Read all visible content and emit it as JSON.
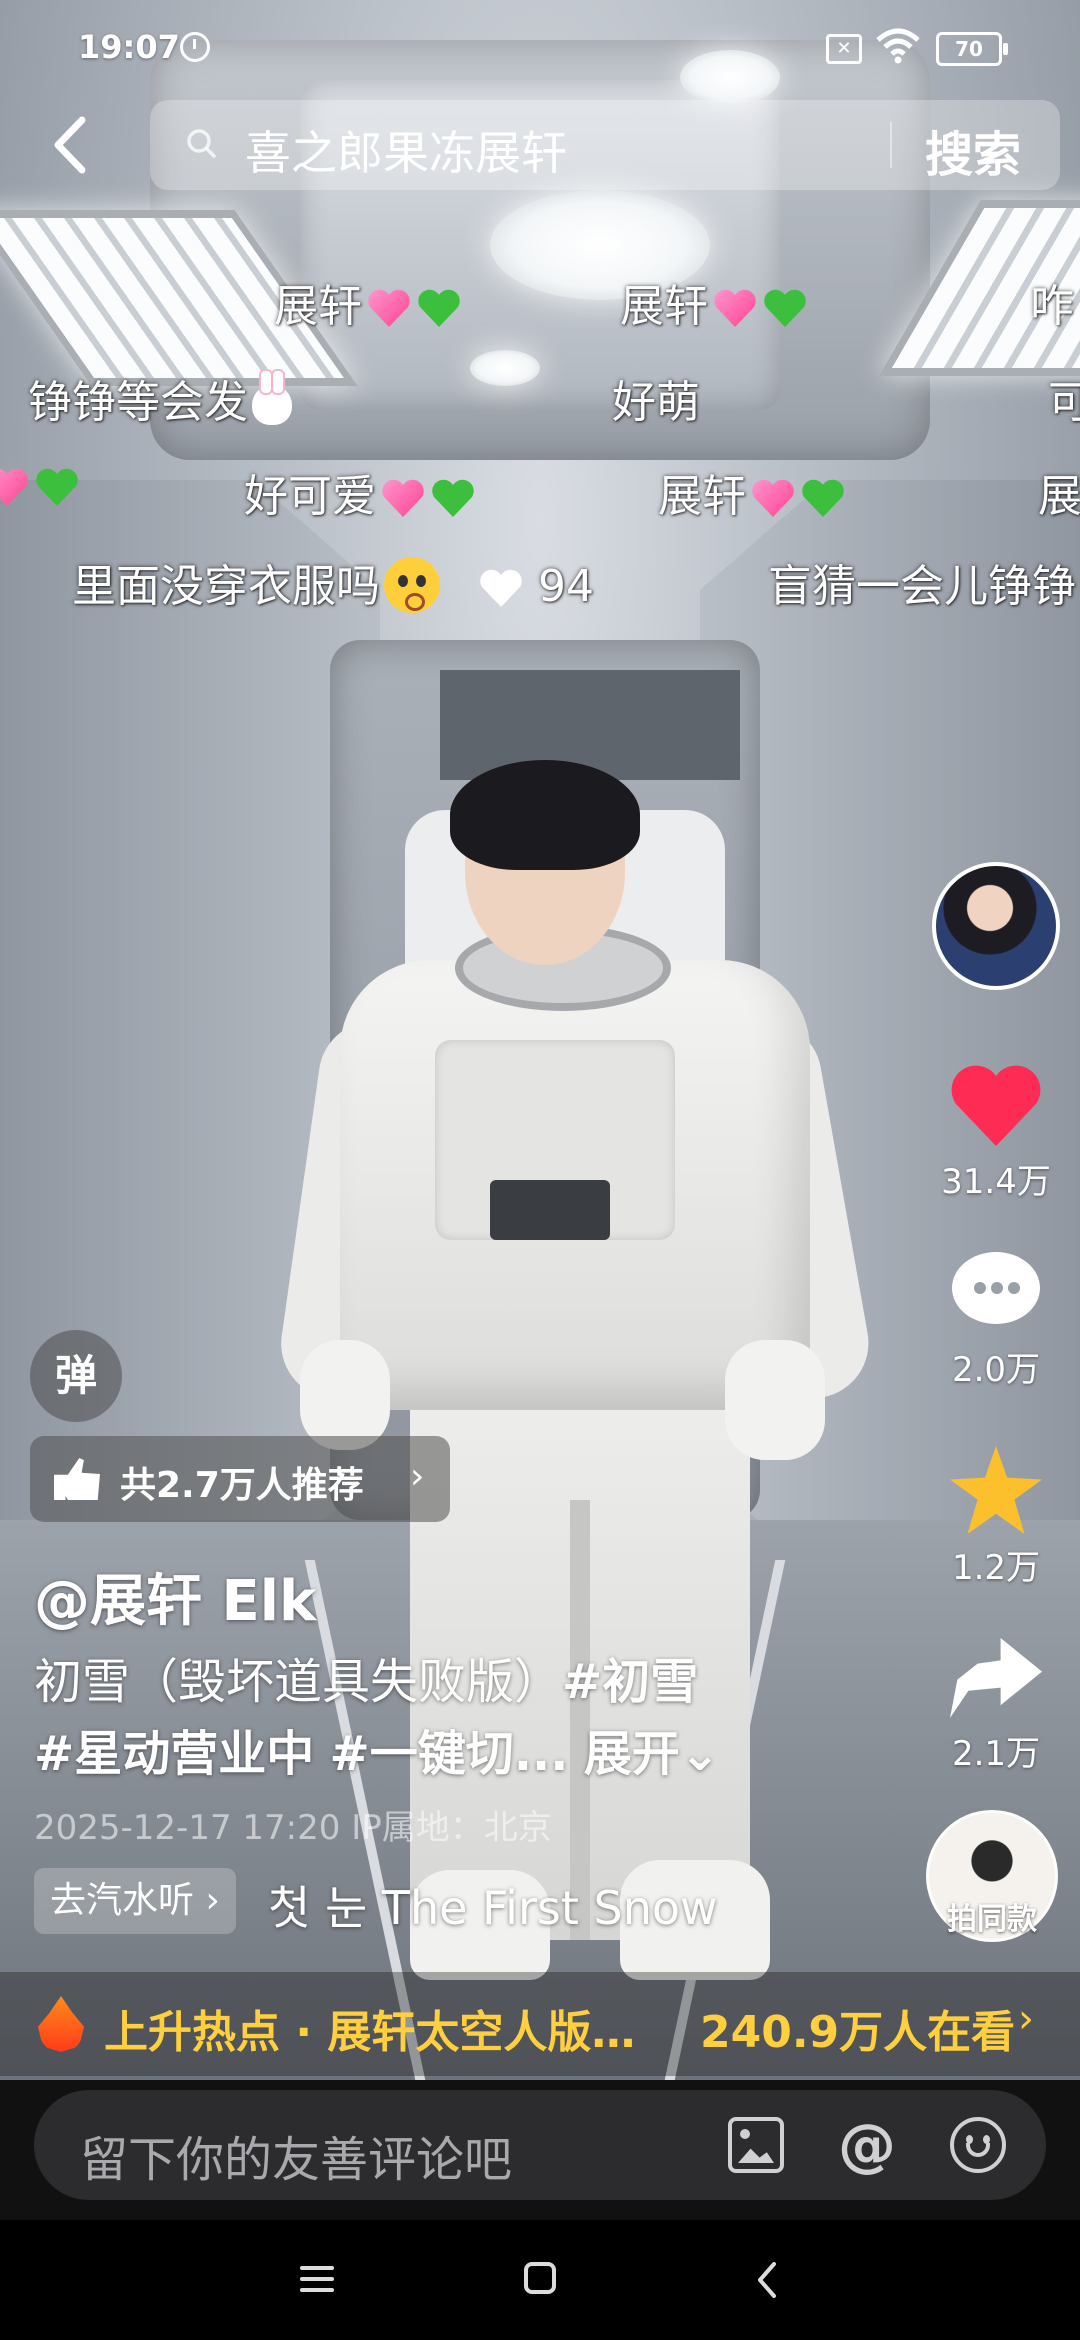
{
  "status_bar": {
    "time": "19:07",
    "battery": "70"
  },
  "search": {
    "query": "喜之郎果冻展轩",
    "button_label": "搜索"
  },
  "danmaku": [
    {
      "text": "展轩",
      "emojis": [
        "sparkling-heart",
        "green-heart"
      ]
    },
    {
      "text": "展轩",
      "emojis": [
        "sparkling-heart",
        "green-heart"
      ]
    },
    {
      "text": "咋"
    },
    {
      "text": "铮铮等会发",
      "emojis": [
        "rabbit"
      ]
    },
    {
      "text": "好萌"
    },
    {
      "text": "可"
    },
    {
      "text": "",
      "emojis": [
        "sparkling-heart",
        "green-heart"
      ]
    },
    {
      "text": "好可爱",
      "emojis": [
        "sparkling-heart",
        "green-heart"
      ]
    },
    {
      "text": "展轩",
      "emojis": [
        "sparkling-heart",
        "green-heart"
      ]
    },
    {
      "text": "展"
    },
    {
      "text": "里面没穿衣服吗",
      "emojis": [
        "flushed-face"
      ],
      "likes": "94"
    },
    {
      "text": "盲猜一会儿铮铮"
    }
  ],
  "actions": {
    "like_count": "31.4万",
    "comment_count": "2.0万",
    "favorite_count": "1.2万",
    "share_count": "2.1万",
    "same_style_label": "拍同款"
  },
  "danmu_toggle": "弹",
  "recommend": {
    "text": "共2.7万人推荐",
    "chevron": "›"
  },
  "author": "@展轩 Elk",
  "description": {
    "line1_text": "初雪（毁坏道具失败版）",
    "line1_tag": "#初雪",
    "line2_tag1": "#星动营业中",
    "line2_tag2": "#一键切...",
    "expand": "展开"
  },
  "meta": {
    "timestamp": "2025-12-17 17:20",
    "ip_location": "IP属地：北京"
  },
  "music": {
    "chip": "去汽水听 ›",
    "title": "첫 눈 The First Snow"
  },
  "hot": {
    "topic": "上升热点 · 展轩太空人版…",
    "viewers": "240.9万人在看"
  },
  "comment_input": {
    "placeholder": "留下你的友善评论吧"
  },
  "colors": {
    "like": "#fe2c55",
    "favorite": "#fcc02d",
    "hot_text": "#ffcf3d"
  }
}
